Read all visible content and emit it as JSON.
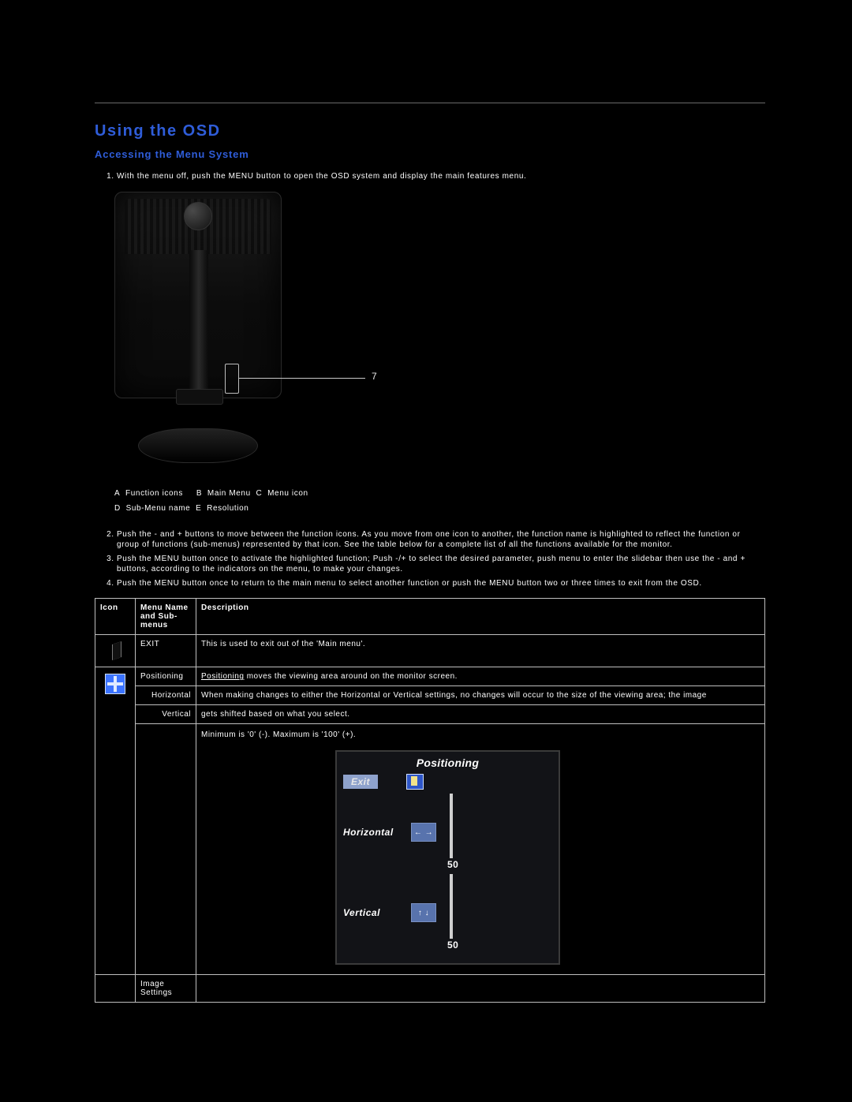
{
  "section": {
    "title": "Using the OSD",
    "subtitle": "Accessing the Menu System"
  },
  "step1": "With the menu off, push the MENU button to open the OSD system and display the main features menu.",
  "callout": "7",
  "legend": {
    "a": "A",
    "a_text": "Function icons",
    "b": "B",
    "b_text": "Main Menu",
    "c": "C",
    "c_text": "Menu icon",
    "d": "D",
    "d_text": "Sub-Menu name",
    "e": "E",
    "e_text": "Resolution"
  },
  "step2": "Push the - and + buttons to move between the function icons. As you move from one icon to another, the function name is highlighted to reflect the function or group of functions (sub-menus) represented by that icon. See the table below for a complete list of all the functions available for the monitor.",
  "step3": "Push the MENU button once to activate the highlighted function; Push -/+ to select the desired parameter, push menu to enter the slidebar then use the - and + buttons, according to the indicators on the menu, to make your changes.",
  "step4": "Push the MENU button once to return to the main menu to select another function or push the MENU button two or three times to exit from the OSD.",
  "table": {
    "headers": {
      "icon": "Icon",
      "name": "Menu Name and Sub-menus",
      "desc": "Description"
    },
    "rows": {
      "exit": {
        "name": "EXIT",
        "desc": "This is used to exit out of the 'Main menu'."
      },
      "positioning": {
        "name": "Positioning",
        "line1_a": "Positioning",
        "line1_b": " moves the viewing area around on the monitor screen.",
        "sub_h_label": "Horizontal",
        "sub_h_desc": "When making changes to either the Horizontal or Vertical settings, no changes will occur to the size of the viewing area; the image",
        "sub_v_label": "Vertical",
        "sub_v_desc": "gets shifted based on what you select.",
        "range": "Minimum is '0' (-). Maximum is '100' (+)."
      },
      "image": {
        "name": "Image Settings"
      }
    }
  },
  "osd": {
    "title": "Positioning",
    "exit_label": "Exit",
    "h_label": "Horizontal",
    "v_label": "Vertical",
    "h_value": "50",
    "v_value": "50",
    "h_arrows": "← →",
    "v_arrows": "↑ ↓"
  }
}
